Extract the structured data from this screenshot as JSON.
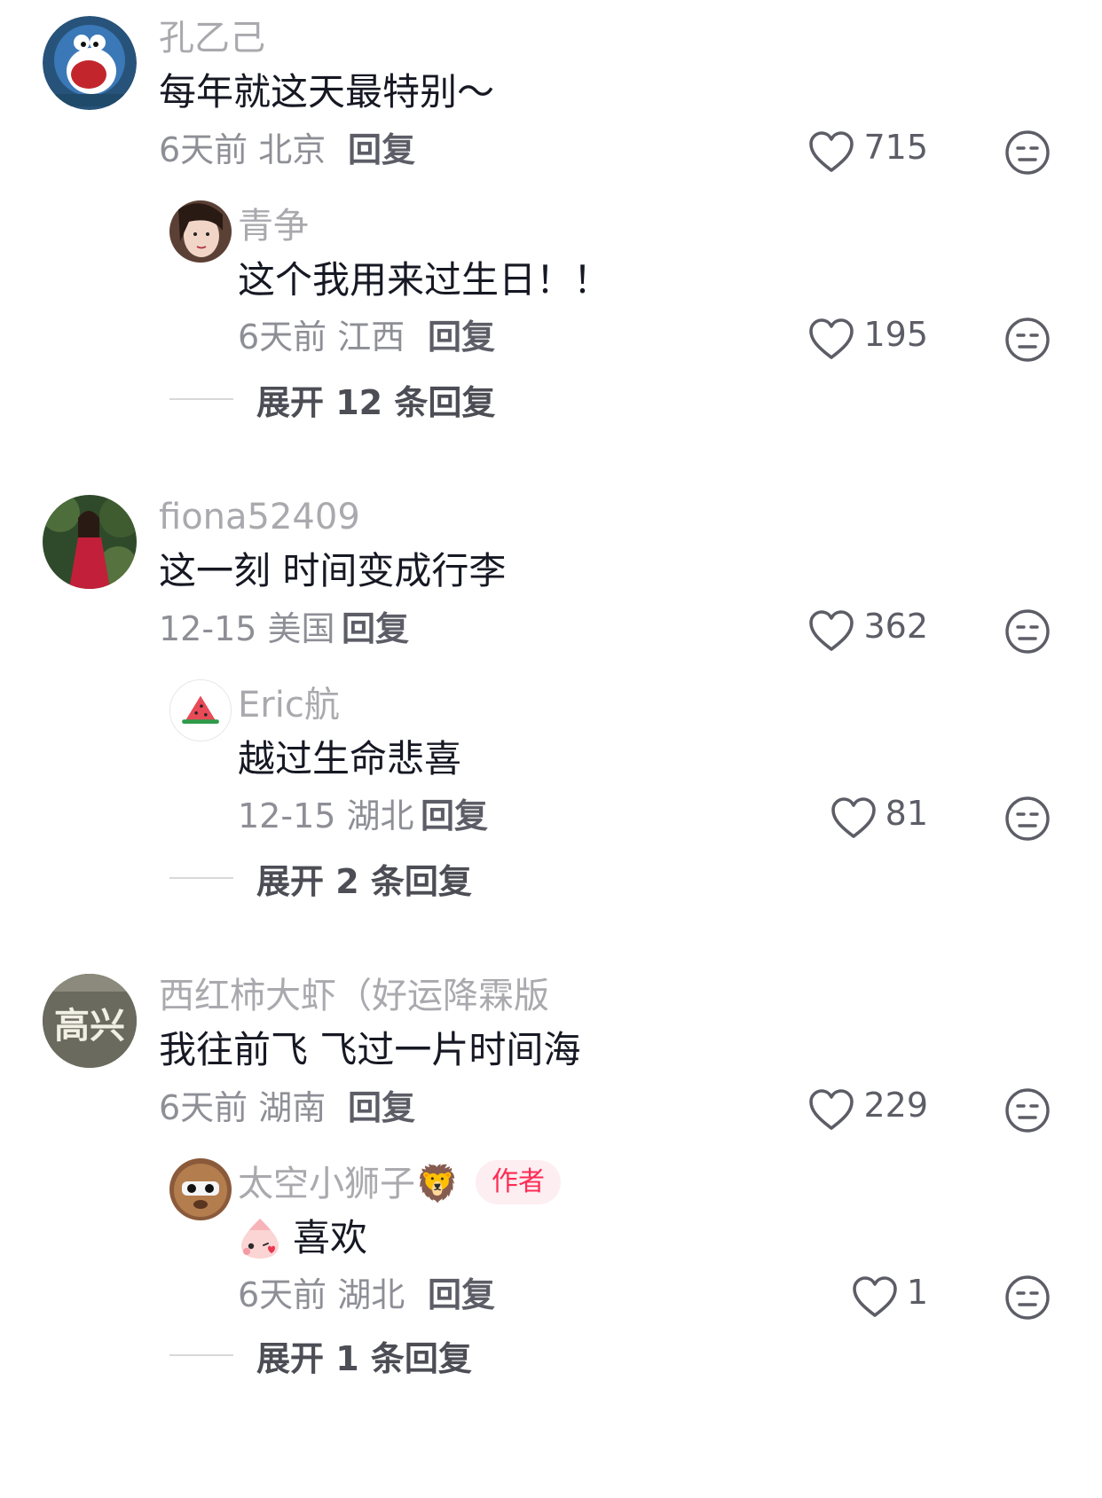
{
  "icons": {
    "like": "heart-outline-icon",
    "dislike": "neutral-face-icon"
  },
  "colors": {
    "username": "#a9a9ae",
    "content": "#161823",
    "meta": "#8e8f96",
    "author_badge_bg": "#fdeef1",
    "author_badge_text": "#fe2c55"
  },
  "comments": [
    {
      "username": "孔乙己",
      "text": "每年就这天最特别～",
      "meta": "6天前 北京",
      "reply_label": "回复",
      "likes": "715",
      "replies": [
        {
          "username": "青争",
          "text": "这个我用来过生日！！",
          "meta": "6天前 江西",
          "reply_label": "回复",
          "likes": "195"
        }
      ],
      "expand_label": "展开 12 条回复"
    },
    {
      "username": "fiona52409",
      "text": "这一刻 时间变成行李",
      "meta": "12-15 美国",
      "reply_label": "回复",
      "likes": "362",
      "replies": [
        {
          "username": "Eric航",
          "text": "越过生命悲喜",
          "meta": "12-15 湖北",
          "reply_label": "回复",
          "likes": "81"
        }
      ],
      "expand_label": "展开 2 条回复"
    },
    {
      "username": "西红柿大虾（好运降霖版",
      "avatar_text": "高兴",
      "text": "我往前飞 飞过一片时间海",
      "meta": "6天前 湖南",
      "reply_label": "回复",
      "likes": "229",
      "replies": [
        {
          "username": "太空小狮子🦁",
          "badge": "作者",
          "text": "喜欢",
          "meta": "6天前 湖北",
          "reply_label": "回复",
          "likes": "1"
        }
      ],
      "expand_label": "展开 1 条回复"
    }
  ]
}
